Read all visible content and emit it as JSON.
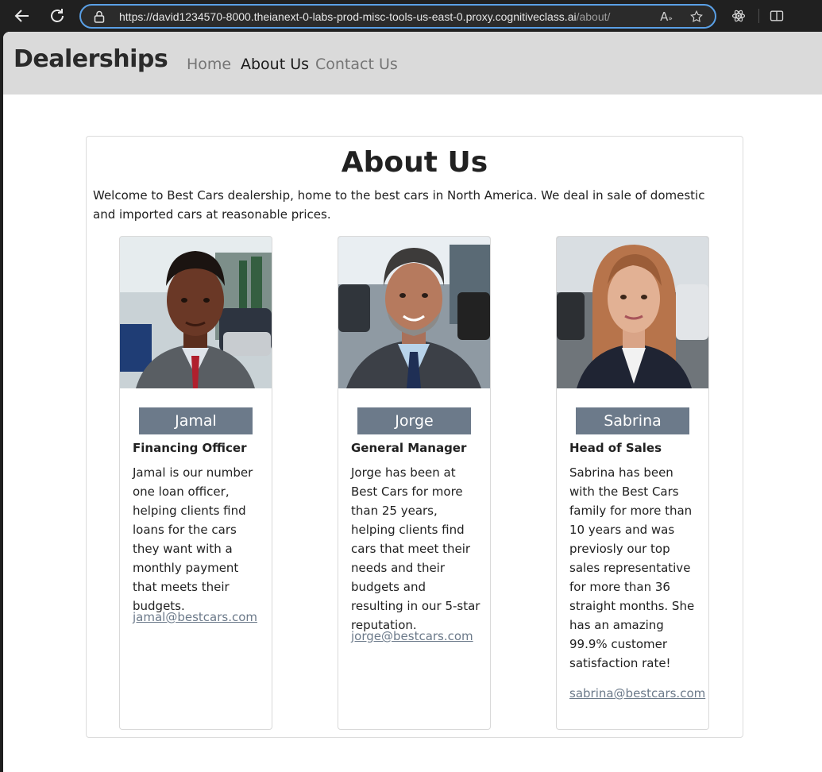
{
  "browser": {
    "url_main": "https://david1234570-8000.theianext-0-labs-prod-misc-tools-us-east-0.proxy.cognitiveclass.ai",
    "url_path": "/about/",
    "accent": "#5aa0e6"
  },
  "navbar": {
    "brand": "Dealerships",
    "links": [
      {
        "label": "Home"
      },
      {
        "label": "About Us"
      },
      {
        "label": "Contact Us"
      }
    ]
  },
  "main": {
    "title": "About Us",
    "intro": "Welcome to Best Cars dealership, home to the best cars in North America. We deal in sale of domestic and imported cars at reasonable prices.",
    "team": [
      {
        "name": "Jamal",
        "role": "Financing Officer",
        "bio": "Jamal is our number one loan officer, helping clients find loans for the cars they want with a monthly payment that meets their budgets.",
        "email": "jamal@bestcars.com"
      },
      {
        "name": "Jorge",
        "role": "General Manager",
        "bio": "Jorge has been at Best Cars for more than 25 years, helping clients find cars that meet their needs and their budgets and resulting in our 5-star reputation.",
        "email": "jorge@bestcars.com"
      },
      {
        "name": "Sabrina",
        "role": "Head of Sales",
        "bio": "Sabrina has been with the Best Cars family for more than 10 years and was previosly our top sales representative for more than 36 straight months. She has an amazing 99.9% customer satisfaction rate!",
        "email": "sabrina@bestcars.com"
      }
    ]
  },
  "colors": {
    "navbar_bg": "#dadada",
    "badge_bg": "#6c7a8a"
  }
}
